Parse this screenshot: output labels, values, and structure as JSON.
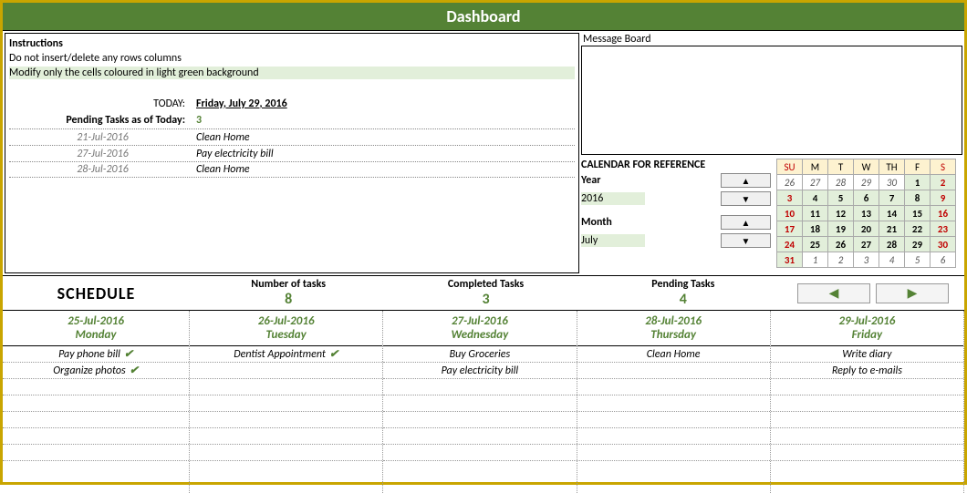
{
  "header": {
    "title": "Dashboard"
  },
  "instructions": {
    "title": "Instructions",
    "line1": "Do not insert/delete any rows columns",
    "line2": "Modify only the cells coloured in light green background"
  },
  "today": {
    "label": "TODAY:",
    "value": "Friday, July 29, 2016"
  },
  "pending_today": {
    "label": "Pending Tasks as of Today:",
    "value": "3"
  },
  "pending_list": [
    {
      "date": "21-Jul-2016",
      "task": "Clean Home"
    },
    {
      "date": "27-Jul-2016",
      "task": "Pay electricity bill"
    },
    {
      "date": "28-Jul-2016",
      "task": "Clean Home"
    }
  ],
  "message_board": {
    "label": "Message Board"
  },
  "calendar": {
    "title": "CALENDAR FOR REFERENCE",
    "year_label": "Year",
    "year_value": "2016",
    "month_label": "Month",
    "month_value": "July",
    "dow": [
      "SU",
      "M",
      "T",
      "W",
      "TH",
      "F",
      "S"
    ],
    "weeks": [
      [
        {
          "d": "26",
          "o": true
        },
        {
          "d": "27",
          "o": true
        },
        {
          "d": "28",
          "o": true
        },
        {
          "d": "29",
          "o": true
        },
        {
          "d": "30",
          "o": true
        },
        {
          "d": "1"
        },
        {
          "d": "2"
        }
      ],
      [
        {
          "d": "3"
        },
        {
          "d": "4"
        },
        {
          "d": "5"
        },
        {
          "d": "6"
        },
        {
          "d": "7"
        },
        {
          "d": "8"
        },
        {
          "d": "9"
        }
      ],
      [
        {
          "d": "10"
        },
        {
          "d": "11"
        },
        {
          "d": "12"
        },
        {
          "d": "13"
        },
        {
          "d": "14"
        },
        {
          "d": "15"
        },
        {
          "d": "16"
        }
      ],
      [
        {
          "d": "17"
        },
        {
          "d": "18"
        },
        {
          "d": "19"
        },
        {
          "d": "20"
        },
        {
          "d": "21"
        },
        {
          "d": "22"
        },
        {
          "d": "23"
        }
      ],
      [
        {
          "d": "24"
        },
        {
          "d": "25"
        },
        {
          "d": "26"
        },
        {
          "d": "27"
        },
        {
          "d": "28"
        },
        {
          "d": "29"
        },
        {
          "d": "30"
        }
      ],
      [
        {
          "d": "31"
        },
        {
          "d": "1",
          "o": true
        },
        {
          "d": "2",
          "o": true
        },
        {
          "d": "3",
          "o": true
        },
        {
          "d": "4",
          "o": true
        },
        {
          "d": "5",
          "o": true
        },
        {
          "d": "6",
          "o": true
        }
      ]
    ]
  },
  "schedule": {
    "title": "SCHEDULE",
    "metrics": {
      "num_label": "Number of tasks",
      "num_val": "8",
      "comp_label": "Completed Tasks",
      "comp_val": "3",
      "pend_label": "Pending Tasks",
      "pend_val": "4"
    },
    "days": [
      {
        "date": "25-Jul-2016",
        "name": "Monday",
        "tasks": [
          {
            "t": "Pay phone bill",
            "c": true
          },
          {
            "t": "Organize photos",
            "c": true
          },
          {
            "t": ""
          },
          {
            "t": ""
          },
          {
            "t": ""
          },
          {
            "t": ""
          },
          {
            "t": ""
          }
        ]
      },
      {
        "date": "26-Jul-2016",
        "name": "Tuesday",
        "tasks": [
          {
            "t": "Dentist Appointment",
            "c": true
          },
          {
            "t": ""
          },
          {
            "t": ""
          },
          {
            "t": ""
          },
          {
            "t": ""
          },
          {
            "t": ""
          },
          {
            "t": ""
          }
        ]
      },
      {
        "date": "27-Jul-2016",
        "name": "Wednesday",
        "tasks": [
          {
            "t": "Buy Groceries"
          },
          {
            "t": "Pay electricity bill"
          },
          {
            "t": ""
          },
          {
            "t": ""
          },
          {
            "t": ""
          },
          {
            "t": ""
          },
          {
            "t": ""
          }
        ]
      },
      {
        "date": "28-Jul-2016",
        "name": "Thursday",
        "tasks": [
          {
            "t": "Clean Home"
          },
          {
            "t": ""
          },
          {
            "t": ""
          },
          {
            "t": ""
          },
          {
            "t": ""
          },
          {
            "t": ""
          },
          {
            "t": ""
          }
        ]
      },
      {
        "date": "29-Jul-2016",
        "name": "Friday",
        "tasks": [
          {
            "t": "Write diary"
          },
          {
            "t": "Reply to e-mails"
          },
          {
            "t": ""
          },
          {
            "t": ""
          },
          {
            "t": ""
          },
          {
            "t": ""
          },
          {
            "t": ""
          }
        ]
      }
    ]
  },
  "glyphs": {
    "up": "▲",
    "down": "▼",
    "left": "◀",
    "right": "▶",
    "check": "✔"
  }
}
